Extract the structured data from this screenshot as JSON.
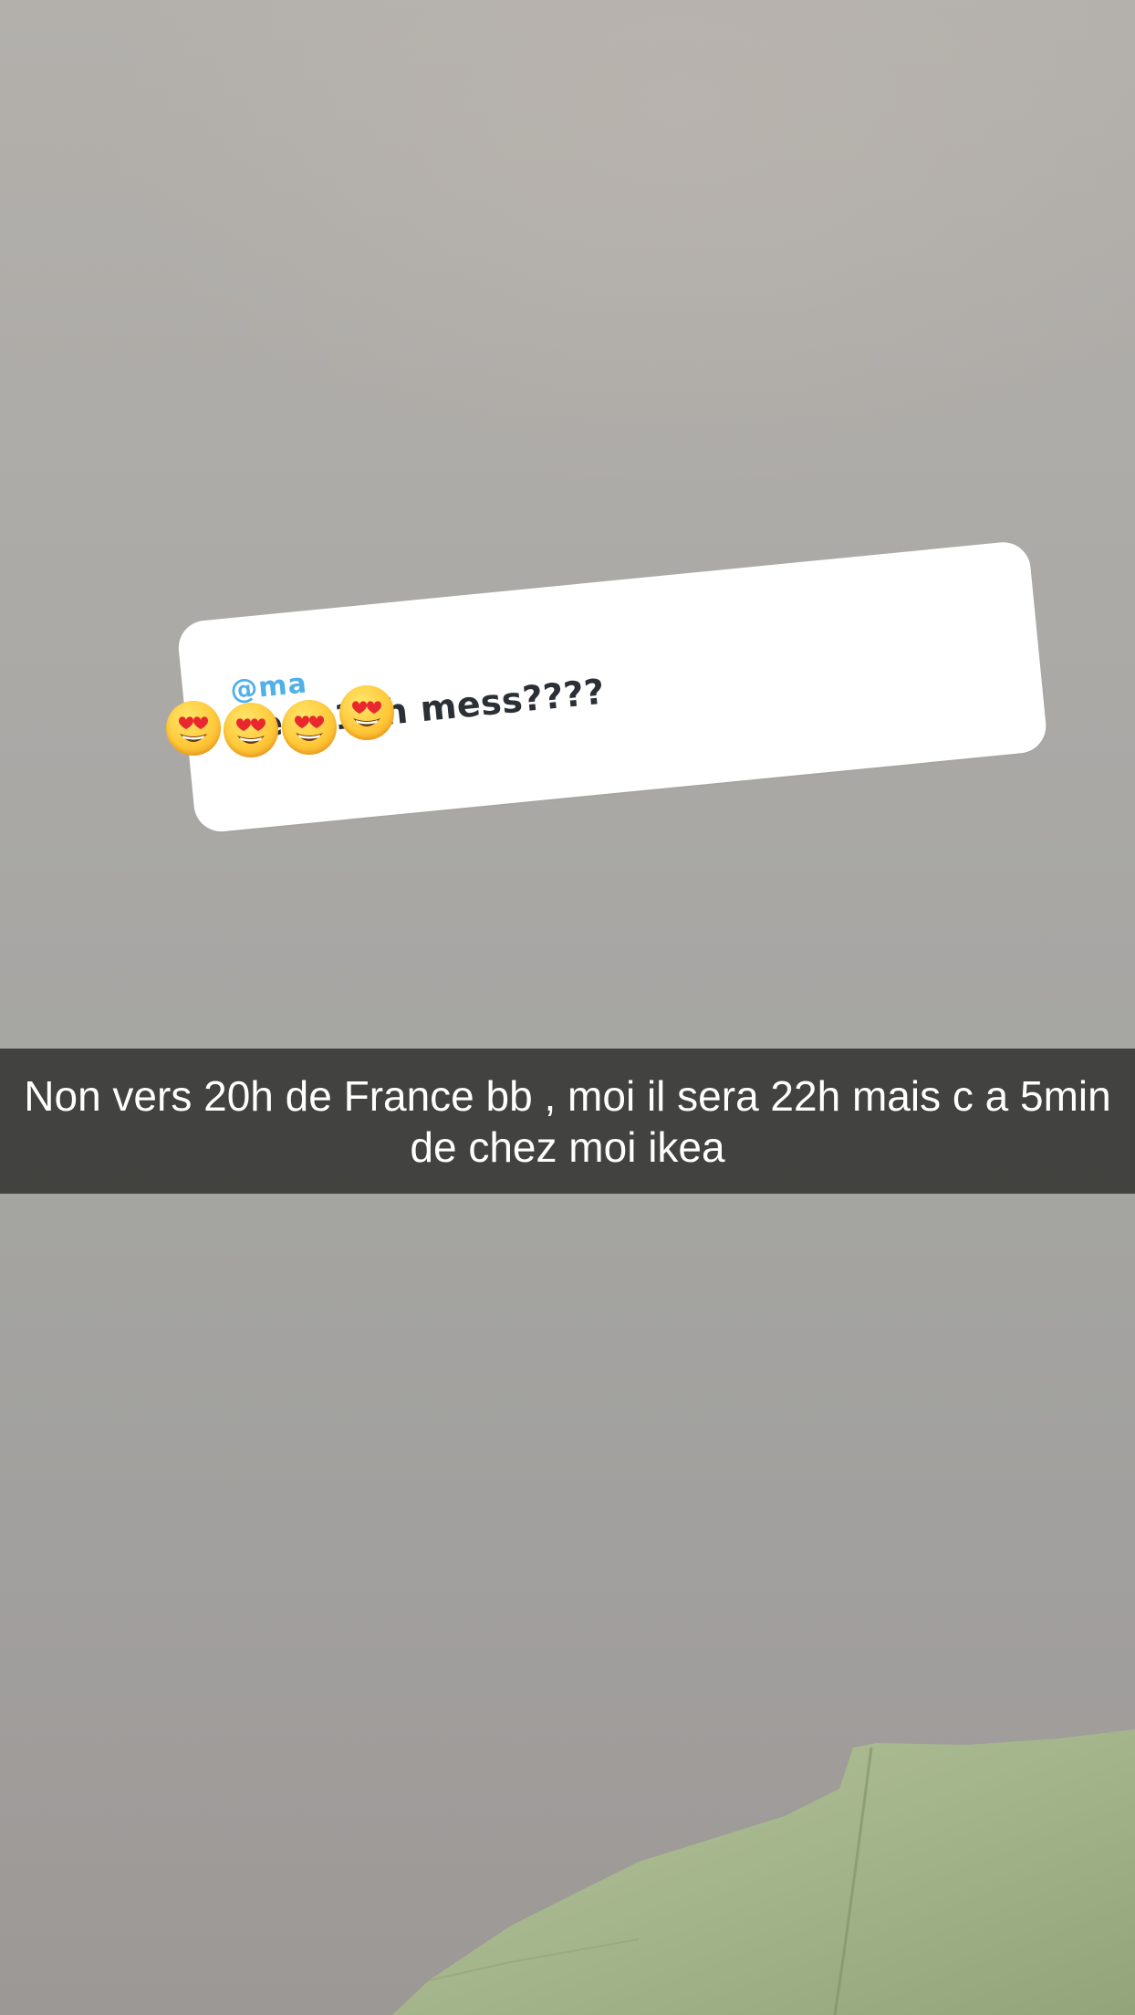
{
  "story": {
    "reply_sticker": {
      "name_text": "@ma",
      "message_text": "Vers 19h mess????",
      "emoji_overlay": [
        "smiling-face-with-heart-eyes",
        "smiling-face-with-heart-eyes",
        "smiling-face-with-heart-eyes",
        "smiling-face-with-heart-eyes"
      ]
    },
    "caption": {
      "text": "Non vers 20h de France bb , moi il sera 22h mais c a 5min de chez moi ikea"
    }
  },
  "colors": {
    "caption_bar": "#3a3a38",
    "reply_name": "#3ea8e6",
    "reply_text": "#2b2f36",
    "fabric": "#a8b88e"
  }
}
